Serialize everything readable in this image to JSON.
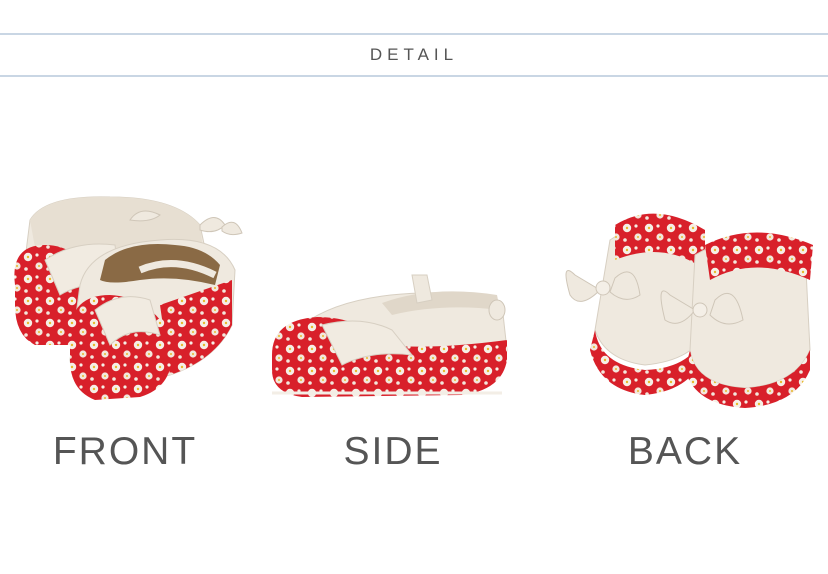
{
  "section": {
    "title": "DETAIL"
  },
  "views": {
    "front": {
      "label": "FRONT",
      "image": "baby-shoes-front-photo"
    },
    "side": {
      "label": "SIDE",
      "image": "baby-shoes-side-photo"
    },
    "back": {
      "label": "BACK",
      "image": "baby-shoes-back-photo"
    }
  },
  "colors": {
    "floral_red": "#d8202a",
    "canvas_cream": "#efe9df",
    "rule_blue": "#c9d6e4",
    "text_gray": "#555555"
  }
}
